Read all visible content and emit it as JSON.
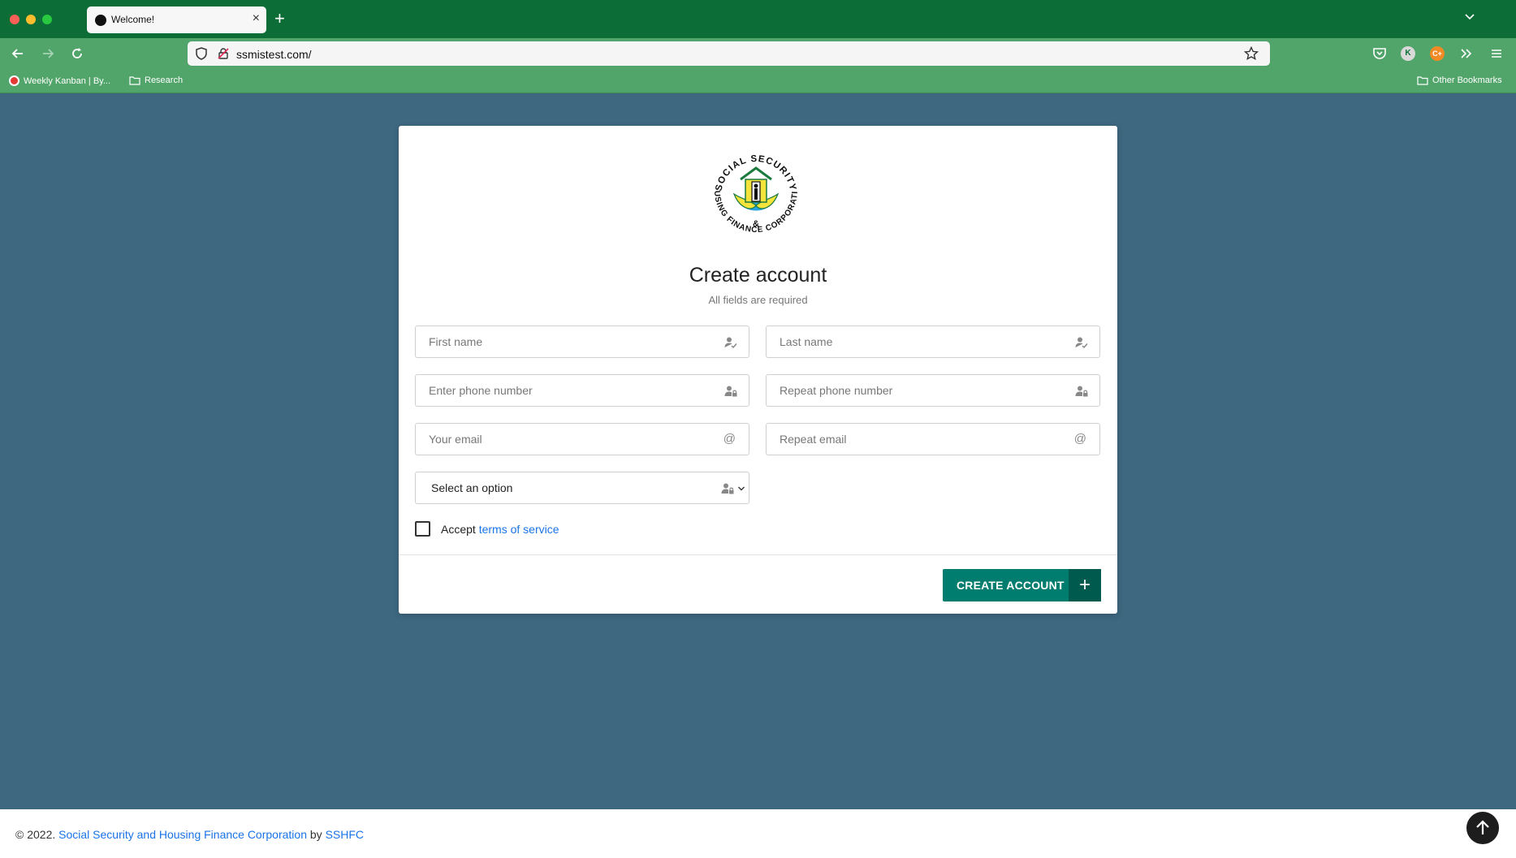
{
  "browser": {
    "tab_title": "Welcome!",
    "url": "ssmistest.com/",
    "bookmarks": [
      "Weekly Kanban | By...",
      "Research"
    ],
    "other_bookmarks": "Other Bookmarks",
    "extension_k": "K",
    "extension_c": "C+"
  },
  "page": {
    "logo_top_text": "SOCIAL SECURITY",
    "logo_bottom_text": "HOUSING FINANCE CORPORATION",
    "logo_ampersand": "&",
    "title": "Create account",
    "subtitle": "All fields are required",
    "fields": {
      "first_name": "First name",
      "last_name": "Last name",
      "phone": "Enter phone number",
      "repeat_phone": "Repeat phone number",
      "email": "Your email",
      "repeat_email": "Repeat email"
    },
    "select_value": "Select an option",
    "accept_label": "Accept",
    "terms_link": "terms of service",
    "submit_label": "CREATE ACCOUNT",
    "submit_icon": "+"
  },
  "footer": {
    "copyright": "© 2022.",
    "org_link": "Social Security and Housing Finance Corporation",
    "by": "by",
    "author_link": "SSHFC"
  },
  "colors": {
    "chrome_dark": "#0c6e36",
    "chrome_light": "#52a56a",
    "page_bg": "#3e6880",
    "primary_button": "#007d6e",
    "link": "#1a73e8"
  },
  "icons": [
    "shield-icon",
    "lock-icon",
    "star-icon",
    "user-check-icon",
    "user-lock-icon",
    "at-icon",
    "chevron-down-icon",
    "plus-icon",
    "arrow-up-icon"
  ]
}
